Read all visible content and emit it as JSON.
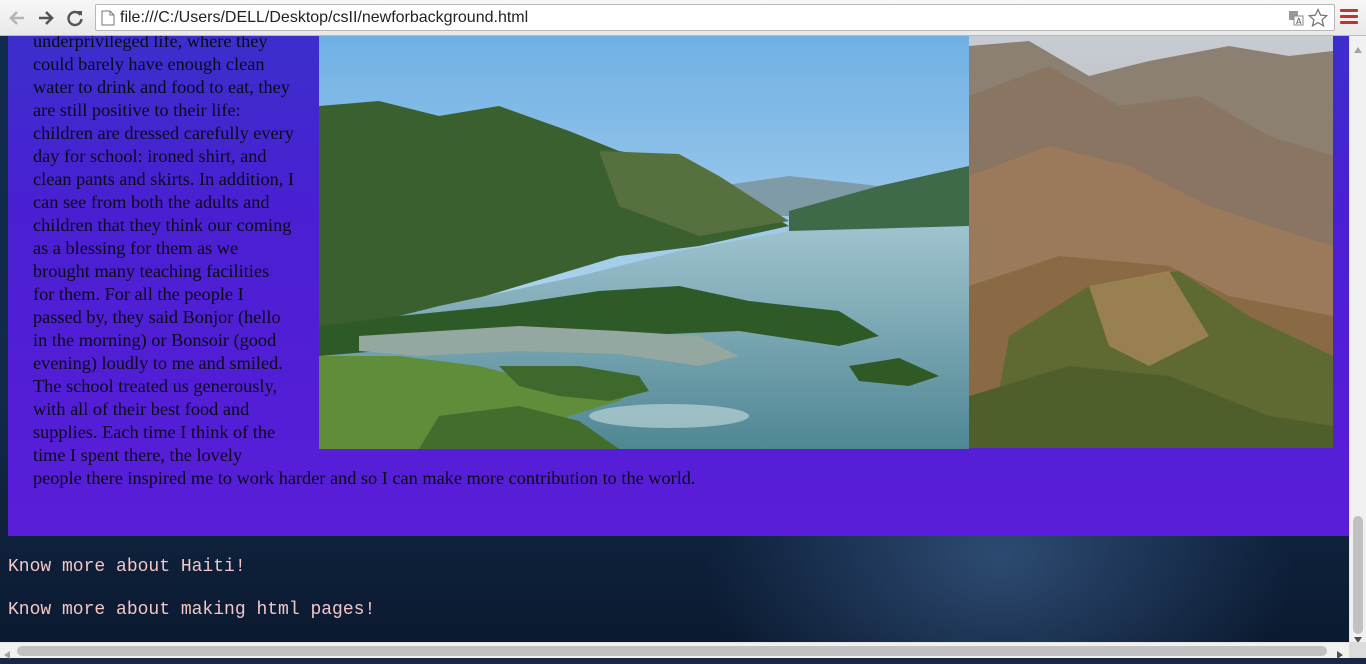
{
  "browser": {
    "url": "file:///C:/Users/DELL/Desktop/csII/newforbackground.html",
    "back_icon": "arrow-left-icon",
    "forward_icon": "arrow-right-icon",
    "reload_icon": "reload-icon",
    "bookmark_icon": "star-icon",
    "menu_icon": "hamburger-menu-icon",
    "accent_menu_color": "#c9302c"
  },
  "article": {
    "lines": [
      "underprivileged life, where they",
      "could barely have enough clean",
      "water to drink and food to eat, they",
      "are still positive to their life:",
      "children are dressed carefully every",
      "day for school: ironed shirt, and",
      "clean pants and skirts. In addition, I",
      "can see from both the adults and",
      "children that they think our coming",
      "as a blessing for them as we",
      "brought many teaching facilities",
      "for them. For all the people I",
      "passed by, they said Bonjor (hello",
      "in the morning) or Bonsoir (good",
      "evening) loudly to me and smiled.",
      "The school treated us generously,",
      "with all of their best food and",
      "supplies. Each time I think of the",
      "time I spent there, the lovely"
    ],
    "last_line": "people there inspired me to work harder and so I can make more contribution to the world.",
    "box_color": "#4a1fd2"
  },
  "links": {
    "haiti": "Know more about Haiti!",
    "html": "Know more about making html pages!",
    "color": "#f2c6c6"
  }
}
